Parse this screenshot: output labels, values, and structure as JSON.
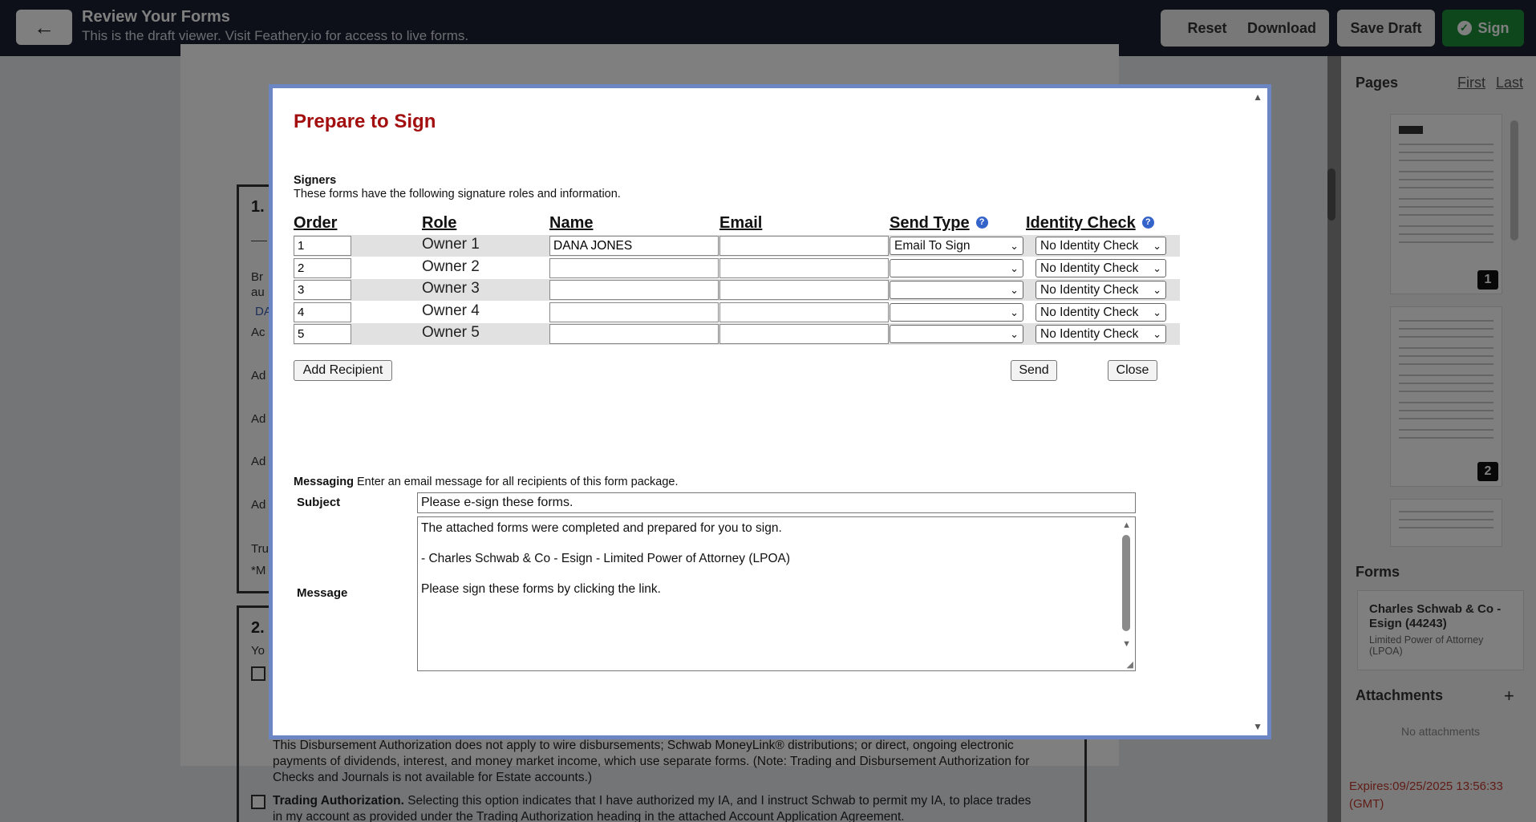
{
  "topbar": {
    "title": "Review Your Forms",
    "subtitle": "This is the draft viewer. Visit Feathery.io for access to live forms.",
    "back_icon": "←",
    "buttons": {
      "reset": "Reset",
      "download": "Download",
      "save_draft": "Save Draft",
      "sign": "Sign"
    }
  },
  "document": {
    "section1": "1.",
    "section2": "2.",
    "fragments": [
      "Br",
      "au",
      "DA",
      "Ac",
      "Ad",
      "Ad",
      "Ad",
      "Ad",
      "Tru",
      "*M",
      "Yo"
    ],
    "para1": "This Disbursement Authorization does not apply to wire disbursements; Schwab MoneyLink® distributions; or direct, ongoing electronic payments of dividends, interest, and money market income, which use separate forms. (Note: Trading and Disbursement Authorization for Checks and Journals is not available for Estate accounts.)",
    "para2_bold": "Trading Authorization.",
    "para2": " Selecting this option indicates that I have authorized my IA, and I instruct Schwab to permit my IA, to place trades in my account as provided under the Trading Authorization heading in the attached Account Application Agreement."
  },
  "right_panel": {
    "pages_title": "Pages",
    "first": "First",
    "last": "Last",
    "thumbs": [
      "1",
      "2"
    ],
    "forms_title": "Forms",
    "form_card_title": "Charles Schwab & Co - Esign (44243)",
    "form_card_sub": "Limited Power of Attorney (LPOA)",
    "attachments_title": "Attachments",
    "attachments_add": "+",
    "no_attachments": "No attachments",
    "expires": "Expires:09/25/2025 13:56:33 (GMT)"
  },
  "modal": {
    "title": "Prepare to Sign",
    "signers_heading": "Signers",
    "signers_desc": "These forms have the following signature roles and information.",
    "columns": {
      "order": "Order",
      "role": "Role",
      "name": "Name",
      "email": "Email",
      "send_type": "Send Type",
      "identity_check": "Identity Check"
    },
    "help_glyph": "?",
    "rows": [
      {
        "order": "1",
        "role": "Owner 1",
        "name": "DANA JONES",
        "email": "",
        "send_type": "Email To Sign",
        "identity_check": "No Identity Check"
      },
      {
        "order": "2",
        "role": "Owner 2",
        "name": "",
        "email": "",
        "send_type": "",
        "identity_check": "No Identity Check"
      },
      {
        "order": "3",
        "role": "Owner 3",
        "name": "",
        "email": "",
        "send_type": "",
        "identity_check": "No Identity Check"
      },
      {
        "order": "4",
        "role": "Owner 4",
        "name": "",
        "email": "",
        "send_type": "",
        "identity_check": "No Identity Check"
      },
      {
        "order": "5",
        "role": "Owner 5",
        "name": "",
        "email": "",
        "send_type": "",
        "identity_check": "No Identity Check"
      }
    ],
    "add_recipient": "Add Recipient",
    "send": "Send",
    "close": "Close",
    "messaging_label": "Messaging",
    "messaging_desc": " Enter an email message for all recipients of this form package.",
    "subject_label": "Subject",
    "subject_value": "Please e-sign these forms.",
    "message_label": "Message",
    "message_lines": [
      "The attached forms were completed and prepared for you to sign.",
      "- Charles Schwab & Co - Esign - Limited Power of Attorney (LPOA)",
      "Please sign these forms by clicking the link."
    ]
  }
}
